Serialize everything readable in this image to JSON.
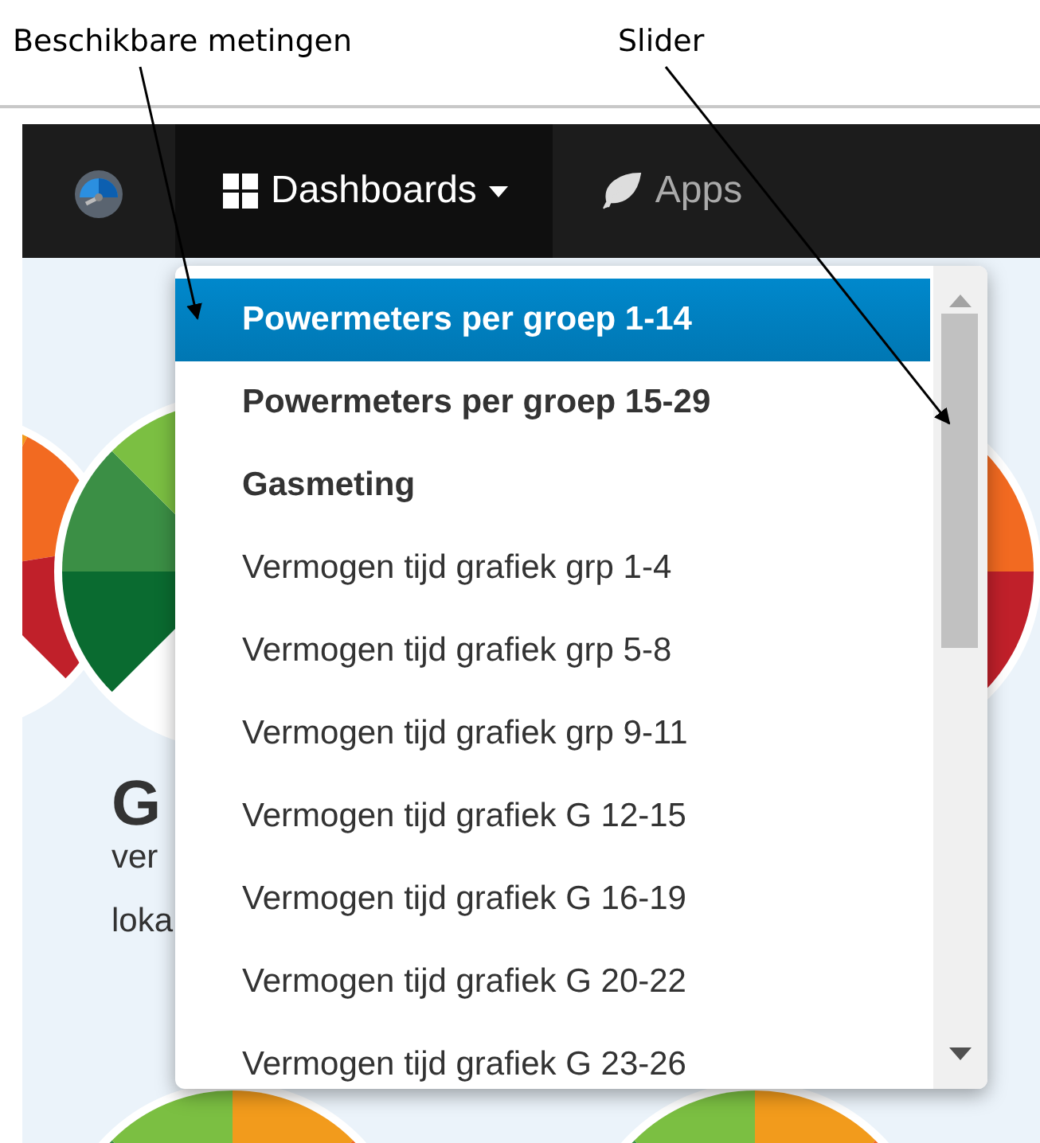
{
  "annotations": [
    {
      "label": "Beschikbare metingen"
    },
    {
      "label": "Slider"
    }
  ],
  "navbar": {
    "items": [
      {
        "kind": "logo",
        "active": false
      },
      {
        "kind": "dropdown",
        "label": "Dashboards",
        "active": true
      },
      {
        "kind": "link",
        "label": "Apps",
        "active": false
      }
    ]
  },
  "gauge_texts": [
    "G",
    "ver",
    "loka"
  ],
  "dropdown": {
    "items": [
      {
        "label": "Powermeters per groep 1-14",
        "kind": "group",
        "selected": true
      },
      {
        "label": "Powermeters per groep 15-29",
        "kind": "group",
        "selected": false
      },
      {
        "label": "Gasmeting",
        "kind": "group",
        "selected": false
      },
      {
        "label": "Vermogen tijd grafiek grp 1-4",
        "kind": "graph",
        "selected": false
      },
      {
        "label": "Vermogen tijd grafiek grp 5-8",
        "kind": "graph",
        "selected": false
      },
      {
        "label": "Vermogen tijd grafiek grp 9-11",
        "kind": "graph",
        "selected": false
      },
      {
        "label": "Vermogen tijd grafiek G 12-15",
        "kind": "graph",
        "selected": false
      },
      {
        "label": "Vermogen tijd grafiek G 16-19",
        "kind": "graph",
        "selected": false
      },
      {
        "label": "Vermogen tijd grafiek G 20-22",
        "kind": "graph",
        "selected": false
      },
      {
        "label": "Vermogen tijd grafiek G 23-26",
        "kind": "graph",
        "selected": false
      }
    ]
  }
}
